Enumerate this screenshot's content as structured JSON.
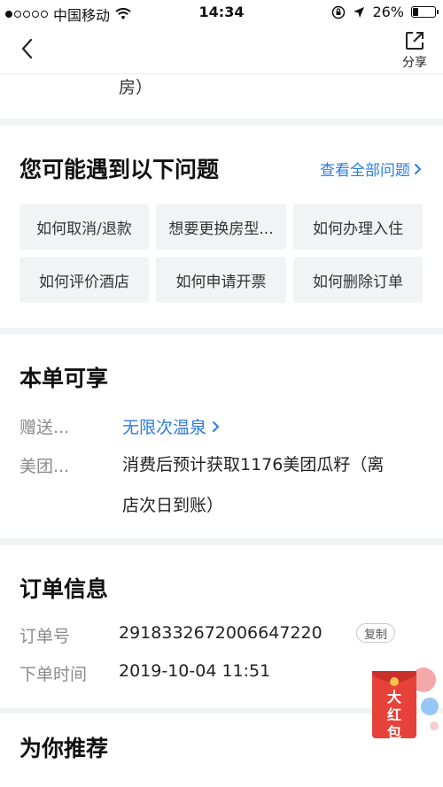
{
  "status_bar": {
    "carrier": "中国移动",
    "time": "14:34",
    "battery": "26%",
    "battery_level": 0.26
  },
  "nav": {
    "share_label": "分享"
  },
  "top_fragment": "房）",
  "faq": {
    "title": "您可能遇到以下问题",
    "see_all": "查看全部问题",
    "items": [
      "如何取消/退款",
      "想要更换房型...",
      "如何办理入住",
      "如何评价酒店",
      "如何申请开票",
      "如何删除订单"
    ]
  },
  "benefits": {
    "title": "本单可享",
    "rows": [
      {
        "label": "赠送...",
        "value": "无限次温泉"
      },
      {
        "label": "美团...",
        "value_line1": "消费后预计获取1176美团瓜籽（离",
        "value_line2": "店次日到账）"
      }
    ]
  },
  "order_info": {
    "title": "订单信息",
    "order_no_label": "订单号",
    "order_no": "2918332672006647220",
    "copy_label": "复制",
    "time_label": "下单时间",
    "time_value": "2019-10-04 11:51"
  },
  "recommend": {
    "title": "为你推荐"
  },
  "red_packet": {
    "line1": "大",
    "line2": "红",
    "line3": "包",
    "color": "#e6423a"
  }
}
